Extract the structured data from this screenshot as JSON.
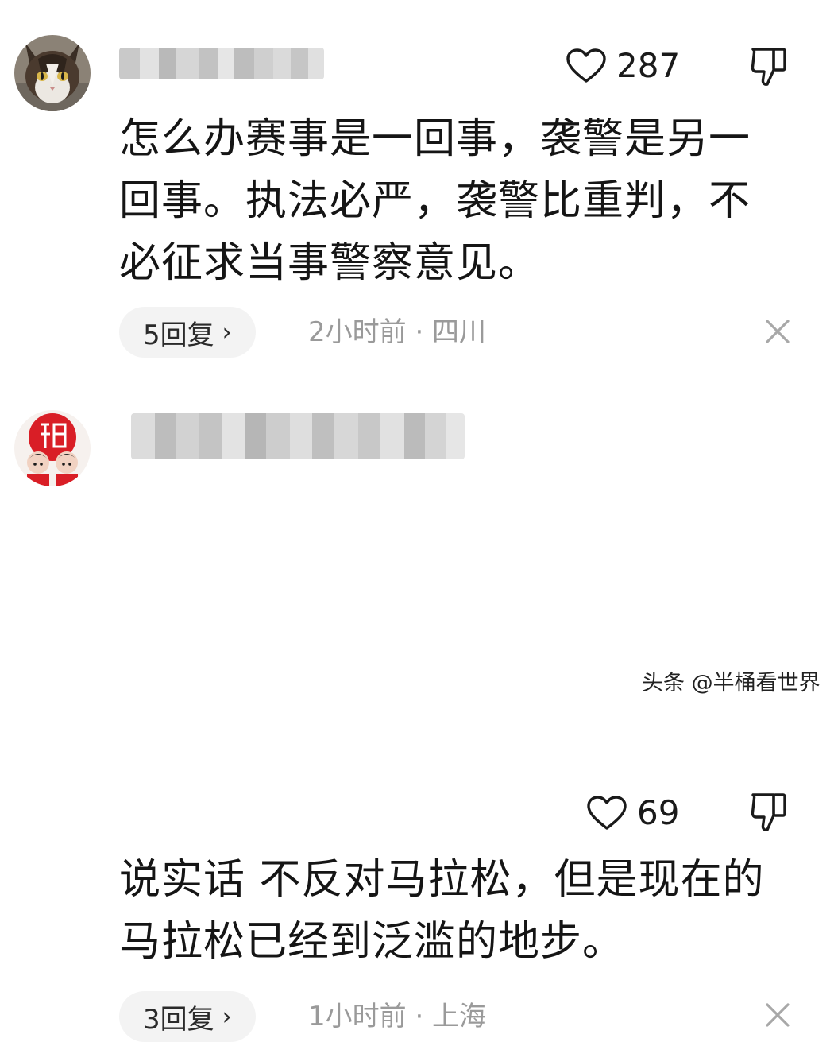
{
  "comments": [
    {
      "likes": "287",
      "text": "怎么办赛事是一回事，袭警是另一回事。执法必严，袭警比重判，不必征求当事警察意见。",
      "replies_label": "5回复",
      "reply_arrow": "›",
      "meta": "2小时前 · 四川",
      "avatar_icon": "cat-avatar-icon"
    },
    {
      "likes": "69",
      "text": "说实话 不反对马拉松，但是现在的马拉松已经到泛滥的地步。",
      "replies_label": "3回复",
      "reply_arrow": "›",
      "meta": "1小时前 · 上海",
      "avatar_icon": "fu-couple-avatar-icon"
    }
  ],
  "icons": {
    "like": "heart-icon",
    "dislike": "thumbs-down-icon",
    "close": "close-icon"
  },
  "watermark": "头条 @半桶看世界",
  "colors": {
    "text": "#151515",
    "meta": "#9a9a9a",
    "pill_bg": "#f3f3f3"
  }
}
